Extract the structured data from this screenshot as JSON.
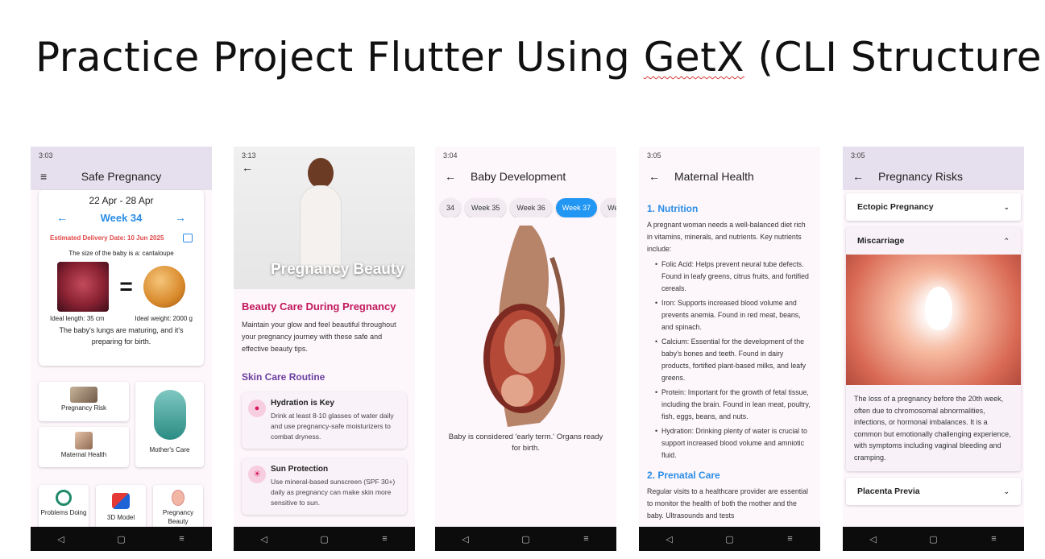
{
  "slide": {
    "title_prefix": "Practice Project Flutter Using ",
    "title_getx": "GetX",
    "title_suffix": " (CLI Structure)"
  },
  "nav_icons": [
    "back-triangle",
    "home-square",
    "recents-menu"
  ],
  "nav_glyphs": [
    "◁",
    "▢",
    "≡"
  ],
  "phone1": {
    "time": "3:03",
    "menu_glyph": "≡",
    "title": "Safe Pregnancy",
    "date_range": "22 Apr - 28 Apr",
    "week_label": "Week 34",
    "prev_glyph": "←",
    "next_glyph": "→",
    "delivery_date": "Estimated Delivery Date: 10 Jun 2025",
    "size_text": "The size of the baby is a: cantaloupe",
    "equals": "=",
    "ideal_length": "Ideal length: 35 cm",
    "ideal_weight": "Ideal weight: 2000 g",
    "development": "The baby's lungs are maturing, and it's preparing for birth.",
    "tiles": {
      "pregnancy_risk": "Pregnancy Risk",
      "mothers_care": "Mother's Care",
      "maternal_health": "Maternal Health",
      "problems_doing": "Problems Doing",
      "model_3d": "3D Model",
      "pregnancy_beauty": "Pregnancy Beauty"
    },
    "accent": "#2b8de6",
    "alert": "#e04848"
  },
  "phone2": {
    "time": "3:13",
    "back_glyph": "←",
    "hero_title": "Pregnancy Beauty",
    "heading": "Beauty Care During Pregnancy",
    "intro": "Maintain your glow and feel beautiful throughout your pregnancy journey with these safe and effective beauty tips.",
    "subheading": "Skin Care Routine",
    "tips": [
      {
        "icon": "water-drop-icon",
        "glyph": "●",
        "title": "Hydration is Key",
        "text": "Drink at least 8-10 glasses of water daily and use pregnancy-safe moisturizers to combat dryness."
      },
      {
        "icon": "sun-icon",
        "glyph": "☀",
        "title": "Sun Protection",
        "text": "Use mineral-based sunscreen (SPF 30+) daily as pregnancy can make skin more sensitive to sun."
      }
    ],
    "heading_color": "#c2185b",
    "sub_color": "#6a3fa0"
  },
  "phone3": {
    "time": "3:04",
    "back_glyph": "←",
    "title": "Baby Development",
    "chips": [
      "34",
      "Week 35",
      "Week 36",
      "Week 37",
      "We"
    ],
    "active_chip": 3,
    "caption": "Baby is considered 'early term.' Organs ready for birth."
  },
  "phone4": {
    "time": "3:05",
    "back_glyph": "←",
    "title": "Maternal Health",
    "sections": [
      {
        "heading": "1. Nutrition",
        "text": "A pregnant woman needs a well-balanced diet rich in vitamins, minerals, and nutrients. Key nutrients include:",
        "bullets": [
          "Folic Acid: Helps prevent neural tube defects. Found in leafy greens, citrus fruits, and fortified cereals.",
          "Iron: Supports increased blood volume and prevents anemia. Found in red meat, beans, and spinach.",
          "Calcium: Essential for the development of the baby's bones and teeth. Found in dairy products, fortified plant-based milks, and leafy greens.",
          "Protein: Important for the growth of fetal tissue, including the brain. Found in lean meat, poultry, fish, eggs, beans, and nuts.",
          "Hydration: Drinking plenty of water is crucial to support increased blood volume and amniotic fluid."
        ]
      },
      {
        "heading": "2. Prenatal Care",
        "text": "Regular visits to a healthcare provider are essential to monitor the health of both the mother and the baby. Ultrasounds and tests"
      }
    ],
    "bullet_glyph": "•"
  },
  "phone5": {
    "time": "3:05",
    "back_glyph": "←",
    "title": "Pregnancy Risks",
    "items": [
      "Ectopic Pregnancy",
      "Miscarriage",
      "Placenta Previa"
    ],
    "chevron_down": "⌄",
    "chevron_up": "⌃",
    "open_text": "The loss of a pregnancy before the 20th week, often due to chromosomal abnormalities, infections, or hormonal imbalances. It is a common but emotionally challenging experience, with symptoms including vaginal bleeding and cramping."
  }
}
